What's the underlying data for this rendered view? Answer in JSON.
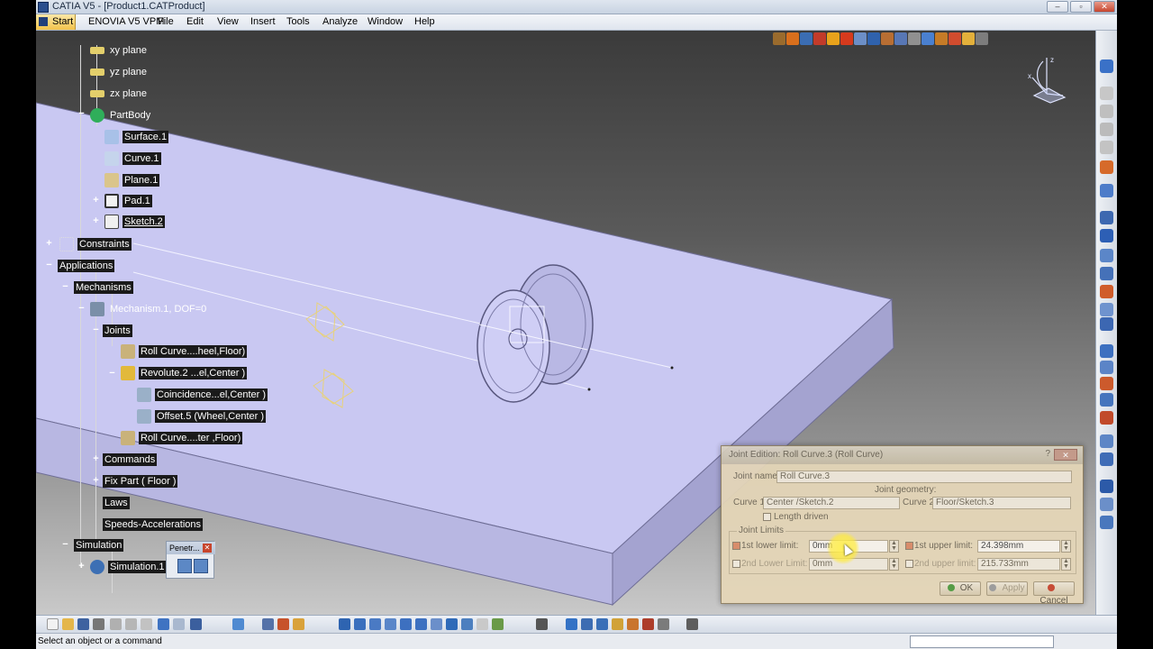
{
  "window": {
    "title": "CATIA V5 - [Product1.CATProduct]",
    "controls": [
      "–",
      "▫",
      "✕"
    ]
  },
  "menubar": {
    "start": "Start",
    "items": [
      "ENOVIA V5 VPM",
      "File",
      "Edit",
      "View",
      "Insert",
      "Tools",
      "Analyze",
      "Window",
      "Help"
    ]
  },
  "tree": {
    "xy_plane": "xy plane",
    "yz_plane": "yz plane",
    "zx_plane": "zx plane",
    "partbody": "PartBody",
    "surface1": "Surface.1",
    "curve1": "Curve.1",
    "plane1": "Plane.1",
    "pad1": "Pad.1",
    "sketch2": "Sketch.2",
    "constraints": "Constraints",
    "applications": "Applications",
    "mechanisms": "Mechanisms",
    "mechanism1": "Mechanism.1, DOF=0",
    "joints": "Joints",
    "roll_curve_wheel": "Roll Curve....heel,Floor)",
    "revolute2": "Revolute.2 ...el,Center )",
    "coincidence": "Coincidence...el,Center )",
    "offset5": "Offset.5 (Wheel,Center )",
    "roll_curve_center": "Roll Curve....ter ,Floor)",
    "commands": "Commands",
    "fix_part": "Fix Part ( Floor )",
    "laws": "Laws",
    "speeds": "Speeds-Accelerations",
    "simulation": "Simulation",
    "simulation1": "Simulation.1"
  },
  "penetration_toolbar": {
    "title": "Penetr...",
    "close": "✕"
  },
  "dialog": {
    "title": "Joint Edition: Roll Curve.3 (Roll Curve)",
    "help": "?",
    "close": "✕",
    "joint_name_label": "Joint name:",
    "joint_name_value": "Roll Curve.3",
    "joint_geometry_label": "Joint geometry:",
    "curve1_label": "Curve 1:",
    "curve1_value": "Center /Sketch.2",
    "curve2_label": "Curve 2:",
    "curve2_value": "Floor/Sketch.3",
    "length_driven_label": "Length driven",
    "joint_limits_label": "Joint Limits",
    "lower1_label": "1st lower limit:",
    "lower1_value": "0mm",
    "upper1_label": "1st upper limit:",
    "upper1_value": "24.398mm",
    "lower2_label": "2nd Lower Limit:",
    "lower2_value": "0mm",
    "upper2_label": "2nd upper limit:",
    "upper2_value": "215.733mm",
    "ok": "OK",
    "apply": "Apply",
    "cancel": "Cancel"
  },
  "status": {
    "text": "Select an object or a command"
  },
  "colors": {
    "floor_top": "#c9c8f2",
    "floor_side": "#aeadd8",
    "wheel": "#bdbde8",
    "highlight": "#fff04a",
    "dialog_bg": "#e6d7b8"
  }
}
